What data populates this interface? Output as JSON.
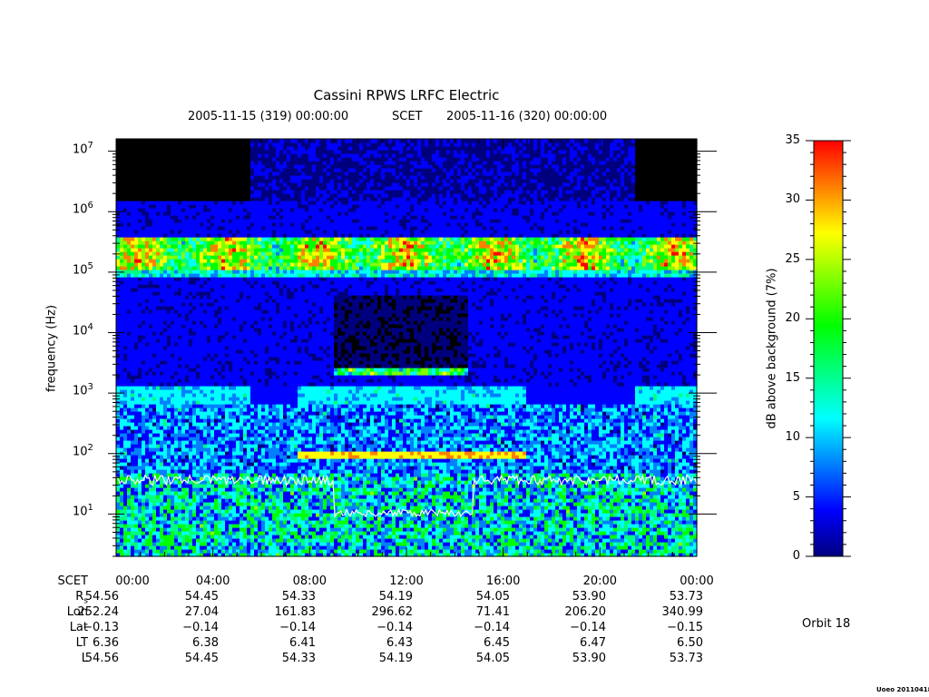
{
  "chart_data": {
    "type": "heatmap",
    "title": "Cassini RPWS LRFC Electric",
    "time_start": "2005-11-15 (319) 00:00:00",
    "time_label": "SCET",
    "time_end": "2005-11-16 (320) 00:00:00",
    "ylabel": "frequency (Hz)",
    "yscale": "log",
    "ylim": [
      2,
      16000000
    ],
    "y_ticks": [
      {
        "base": "10",
        "exp": "1",
        "value": 10
      },
      {
        "base": "10",
        "exp": "2",
        "value": 100
      },
      {
        "base": "10",
        "exp": "3",
        "value": 1000
      },
      {
        "base": "10",
        "exp": "4",
        "value": 10000
      },
      {
        "base": "10",
        "exp": "5",
        "value": 100000
      },
      {
        "base": "10",
        "exp": "6",
        "value": 1000000
      },
      {
        "base": "10",
        "exp": "7",
        "value": 10000000
      }
    ],
    "xlim_hours": [
      0,
      24
    ],
    "x_ticks": [
      "00:00",
      "04:00",
      "08:00",
      "12:00",
      "16:00",
      "20:00",
      "00:00"
    ],
    "colorbar": {
      "label": "dB above background (7%)",
      "range": [
        0,
        35
      ],
      "ticks": [
        "0",
        "5",
        "10",
        "15",
        "20",
        "25",
        "30",
        "35"
      ],
      "colors": [
        "#00007f",
        "#0000ff",
        "#0080ff",
        "#00ffff",
        "#00ff80",
        "#00ff00",
        "#80ff00",
        "#ffff00",
        "#ff8000",
        "#ff0000"
      ]
    },
    "ephemeris": [
      {
        "label": "SCET",
        "values": [
          "00:00",
          "04:00",
          "08:00",
          "12:00",
          "16:00",
          "20:00",
          "00:00"
        ]
      },
      {
        "label": "R",
        "sub": "s",
        "values": [
          "54.56",
          "54.45",
          "54.33",
          "54.19",
          "54.05",
          "53.90",
          "53.73"
        ]
      },
      {
        "label": "Lon",
        "values": [
          "252.24",
          "27.04",
          "161.83",
          "296.62",
          "71.41",
          "206.20",
          "340.99"
        ]
      },
      {
        "label": "Lat",
        "values": [
          "−0.13",
          "−0.14",
          "−0.14",
          "−0.14",
          "−0.14",
          "−0.14",
          "−0.15"
        ]
      },
      {
        "label": "LT",
        "values": [
          "6.36",
          "6.38",
          "6.41",
          "6.43",
          "6.45",
          "6.47",
          "6.50"
        ]
      },
      {
        "label": "L",
        "values": [
          "54.56",
          "54.45",
          "54.33",
          "54.19",
          "54.05",
          "53.90",
          "53.73"
        ]
      }
    ],
    "orbit": "Orbit 18",
    "footer": "Uoeo 20110418"
  }
}
